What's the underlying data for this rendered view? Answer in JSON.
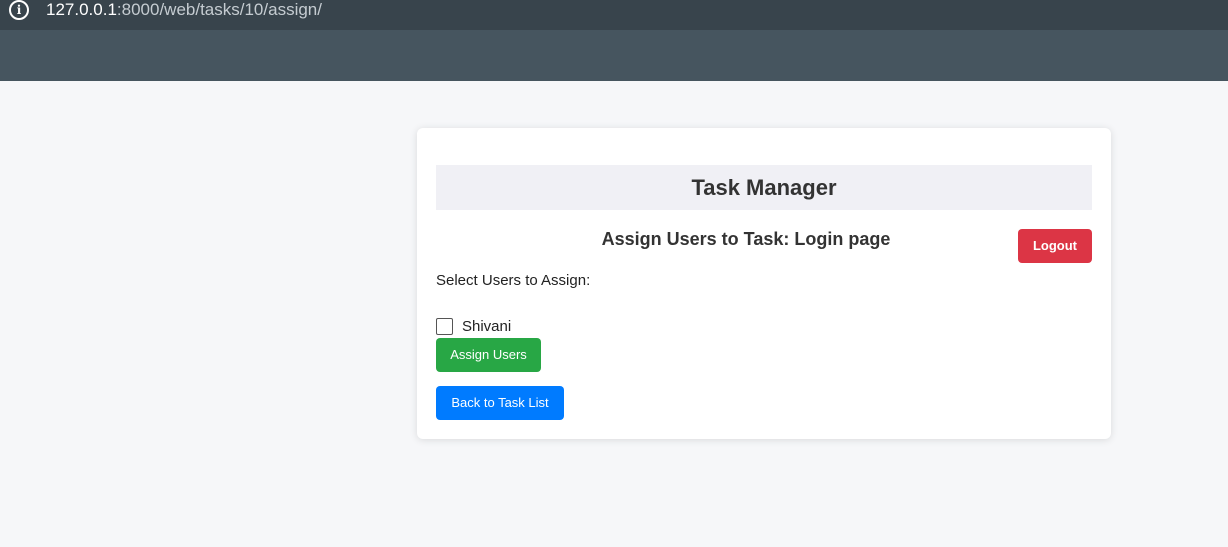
{
  "browser": {
    "url_host": "127.0.0.1",
    "url_rest": ":8000/web/tasks/10/assign/"
  },
  "app": {
    "title": "Task Manager",
    "subtitle": "Assign Users to Task: Login page",
    "logout_label": "Logout"
  },
  "form": {
    "select_label": "Select Users to Assign:",
    "users": [
      {
        "name": "Shivani",
        "checked": false
      }
    ],
    "assign_label": "Assign Users",
    "back_label": "Back to Task List"
  },
  "colors": {
    "logout": "#dc3545",
    "assign": "#28a745",
    "back": "#007bff"
  }
}
